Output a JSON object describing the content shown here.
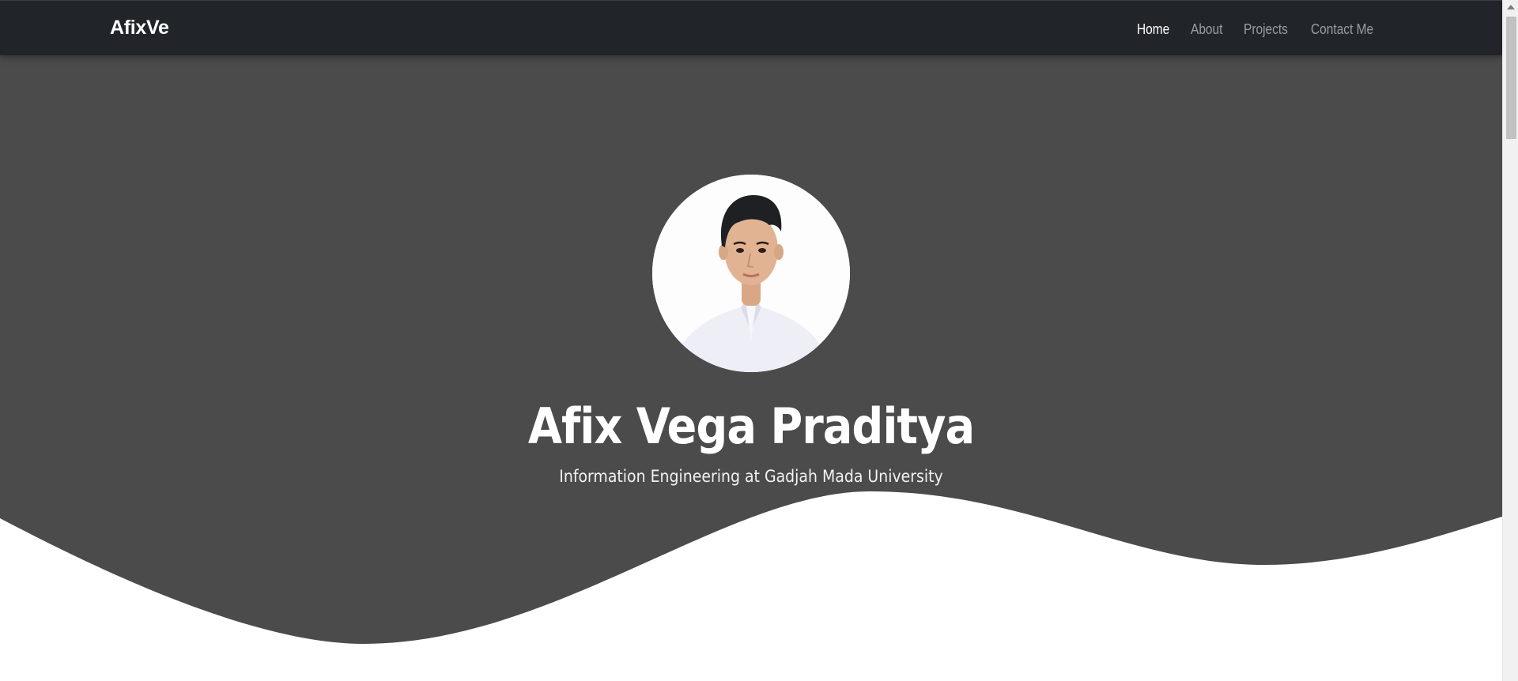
{
  "navbar": {
    "brand": "AfixVe",
    "links": [
      {
        "label": "Home",
        "active": true
      },
      {
        "label": "About",
        "active": false
      },
      {
        "label": "Projects",
        "active": false
      },
      {
        "label": "Contact Me",
        "active": false
      }
    ]
  },
  "hero": {
    "name": "Afix Vega Praditya",
    "subtitle": "Information Engineering at Gadjah Mada University",
    "avatar_icon": "profile-photo"
  },
  "colors": {
    "navbar_bg": "#212529",
    "hero_bg": "#4b4b4b",
    "nav_active": "#ffffff",
    "nav_inactive": "#9a9da0",
    "wave_fill": "#ffffff"
  }
}
